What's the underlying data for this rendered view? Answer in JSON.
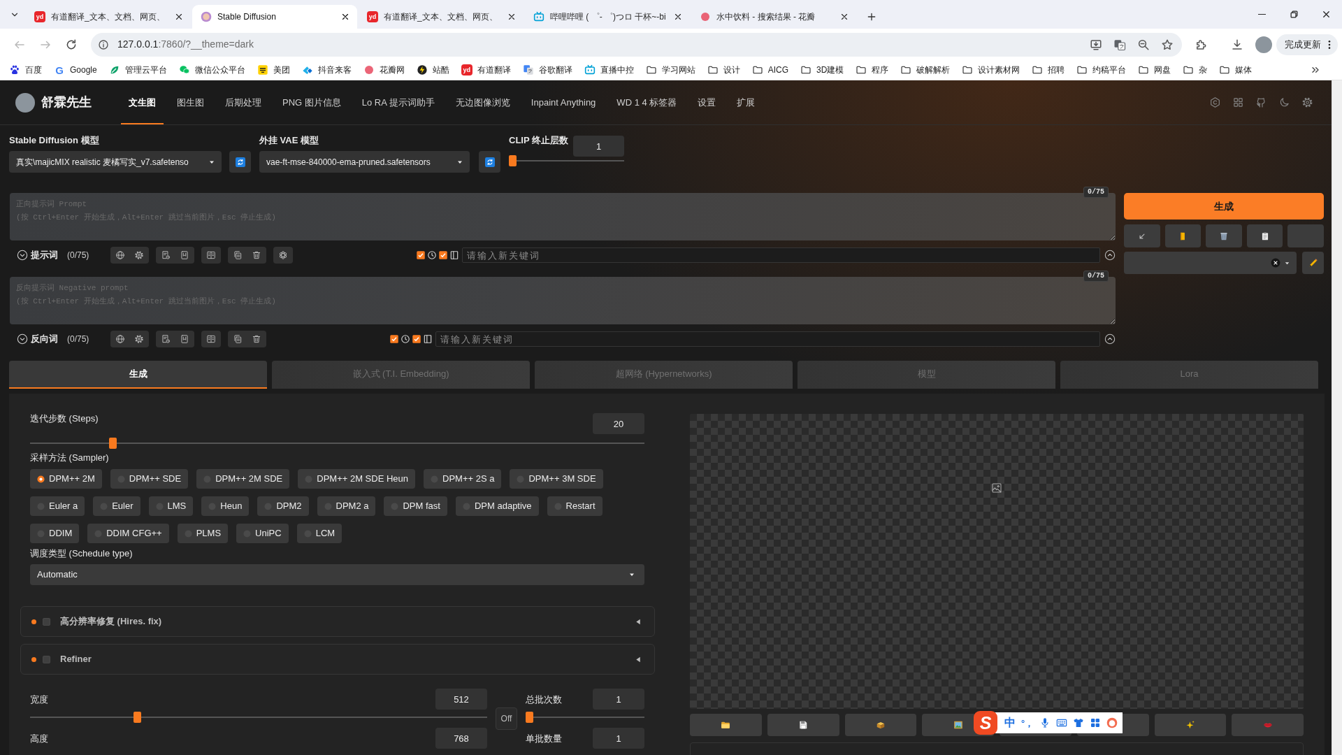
{
  "browser": {
    "tabs": [
      {
        "title": "有道翻译_文本、文档、网页、",
        "kind": "tile",
        "icon_text": "yd",
        "selected": false
      },
      {
        "title": "Stable Diffusion",
        "kind": "face",
        "selected": true
      },
      {
        "title": "有道翻译_文本、文档、网页、",
        "kind": "tile",
        "icon_text": "yd",
        "selected": false
      },
      {
        "title": "哔哩哔哩 ( ゜- ゜)つロ 干杯~-bi",
        "kind": "tv",
        "selected": false
      },
      {
        "title": "水中饮料 - 搜索结果 - 花瓣",
        "kind": "blob",
        "selected": false
      }
    ],
    "back": {
      "disabled": true
    },
    "forward": {
      "disabled": true
    },
    "url": {
      "host": "127.0.0.1",
      "rest": ":7860/?__theme=dark"
    },
    "update_button": "完成更新",
    "bookmarks": [
      {
        "label": "百度",
        "kind": "paw"
      },
      {
        "label": "Google",
        "kind": "letter",
        "icon_text": "G"
      },
      {
        "label": "管理云平台",
        "kind": "leaf"
      },
      {
        "label": "微信公众平台",
        "kind": "chat"
      },
      {
        "label": "美团",
        "kind": "square"
      },
      {
        "label": "抖音来客",
        "kind": "wing"
      },
      {
        "label": "花瓣网",
        "kind": "blob"
      },
      {
        "label": "站酷",
        "kind": "bolt"
      },
      {
        "label": "有道翻译",
        "kind": "tile",
        "icon_text": "yd"
      },
      {
        "label": "谷歌翻译",
        "kind": "translate"
      },
      {
        "label": "直播中控",
        "kind": "tv"
      },
      {
        "label": "学习网站",
        "kind": "folder"
      },
      {
        "label": "设计",
        "kind": "folder"
      },
      {
        "label": "AICG",
        "kind": "folder"
      },
      {
        "label": "3D建模",
        "kind": "folder"
      },
      {
        "label": "程序",
        "kind": "folder"
      },
      {
        "label": "破解解析",
        "kind": "folder"
      },
      {
        "label": "设计素材网",
        "kind": "folder"
      },
      {
        "label": "招聘",
        "kind": "folder"
      },
      {
        "label": "约稿平台",
        "kind": "folder"
      },
      {
        "label": "网盘",
        "kind": "folder"
      },
      {
        "label": "杂",
        "kind": "folder"
      },
      {
        "label": "媒体",
        "kind": "folder"
      }
    ]
  },
  "app": {
    "brand": "舒霖先生",
    "nav": [
      {
        "label": "文生图",
        "selected": true
      },
      {
        "label": "图生图",
        "selected": false
      },
      {
        "label": "后期处理",
        "selected": false
      },
      {
        "label": "PNG 图片信息",
        "selected": false
      },
      {
        "label": "Lo RA 提示词助手",
        "selected": false
      },
      {
        "label": "无边图像浏览",
        "selected": false
      },
      {
        "label": "Inpaint Anything",
        "selected": false
      },
      {
        "label": "WD 1 4 标签器",
        "selected": false
      },
      {
        "label": "设置",
        "selected": false
      },
      {
        "label": "扩展",
        "selected": false
      }
    ],
    "checkpoint": {
      "label": "Stable Diffusion 模型",
      "value": "真实\\majicMIX realistic 麦橘写实_v7.safetenso"
    },
    "vae": {
      "label": "外挂 VAE 模型",
      "value": "vae-ft-mse-840000-ema-pruned.safetensors"
    },
    "clip_skip": {
      "label": "CLIP 终止层数",
      "value": "1",
      "level": 0
    },
    "prompts": [
      {
        "placeholder": "正向提示词 Prompt\n(按 Ctrl+Enter 开始生成，Alt+Enter 跳过当前图片，Esc 停止生成)",
        "counter": "0/75",
        "title": "提示词",
        "count": "(0/75)",
        "assist_button": true,
        "toggles": [
          {
            "checked": true
          },
          {
            "checked": true
          }
        ],
        "keyword_placeholder": "请输入新关键词"
      },
      {
        "placeholder": "反向提示词 Negative prompt\n(按 Ctrl+Enter 开始生成，Alt+Enter 跳过当前图片，Esc 停止生成)",
        "counter": "0/75",
        "title": "反向词",
        "count": "(0/75)",
        "assist_button": false,
        "toggles": [
          {
            "checked": true
          },
          {
            "checked": true
          }
        ],
        "keyword_placeholder": "请输入新关键词"
      }
    ],
    "generate_button": "生成",
    "tabs": [
      {
        "label": "生成",
        "selected": true
      },
      {
        "label": "嵌入式 (T.I. Embedding)",
        "selected": false
      },
      {
        "label": "超网络 (Hypernetworks)",
        "selected": false
      },
      {
        "label": "模型",
        "selected": false
      },
      {
        "label": "Lora",
        "selected": false
      }
    ],
    "steps": {
      "label": "迭代步数 (Steps)",
      "value": "20",
      "level": 0.13
    },
    "sampler": {
      "label": "采样方法 (Sampler)",
      "options": [
        {
          "label": "DPM++ 2M",
          "selected": true
        },
        {
          "label": "DPM++ SDE",
          "selected": false
        },
        {
          "label": "DPM++ 2M SDE",
          "selected": false
        },
        {
          "label": "DPM++ 2M SDE Heun",
          "selected": false
        },
        {
          "label": "DPM++ 2S a",
          "selected": false
        },
        {
          "label": "DPM++ 3M SDE",
          "selected": false
        },
        {
          "label": "Euler a",
          "selected": false
        },
        {
          "label": "Euler",
          "selected": false
        },
        {
          "label": "LMS",
          "selected": false
        },
        {
          "label": "Heun",
          "selected": false
        },
        {
          "label": "DPM2",
          "selected": false
        },
        {
          "label": "DPM2 a",
          "selected": false
        },
        {
          "label": "DPM fast",
          "selected": false
        },
        {
          "label": "DPM adaptive",
          "selected": false
        },
        {
          "label": "Restart",
          "selected": false
        },
        {
          "label": "DDIM",
          "selected": false
        },
        {
          "label": "DDIM CFG++",
          "selected": false
        },
        {
          "label": "PLMS",
          "selected": false
        },
        {
          "label": "UniPC",
          "selected": false
        },
        {
          "label": "LCM",
          "selected": false
        }
      ]
    },
    "schedule": {
      "label": "调度类型 (Schedule type)",
      "value": "Automatic"
    },
    "accordions": [
      {
        "label": "高分辨率修复 (Hires. fix)",
        "checked": false,
        "expanded": false
      },
      {
        "label": "Refiner",
        "checked": false,
        "expanded": false
      }
    ],
    "width": {
      "label": "宽度",
      "value": "512",
      "level": 0.23
    },
    "aspect_button": "Off",
    "batch_count": {
      "label": "总批次数",
      "value": "1",
      "level": 0
    },
    "height": {
      "label": "高度",
      "value": "768"
    },
    "batch_size": {
      "label": "单批数量",
      "value": "1"
    }
  },
  "ime": {
    "logo": "S",
    "mode": "中",
    "punctuation": "°，"
  }
}
